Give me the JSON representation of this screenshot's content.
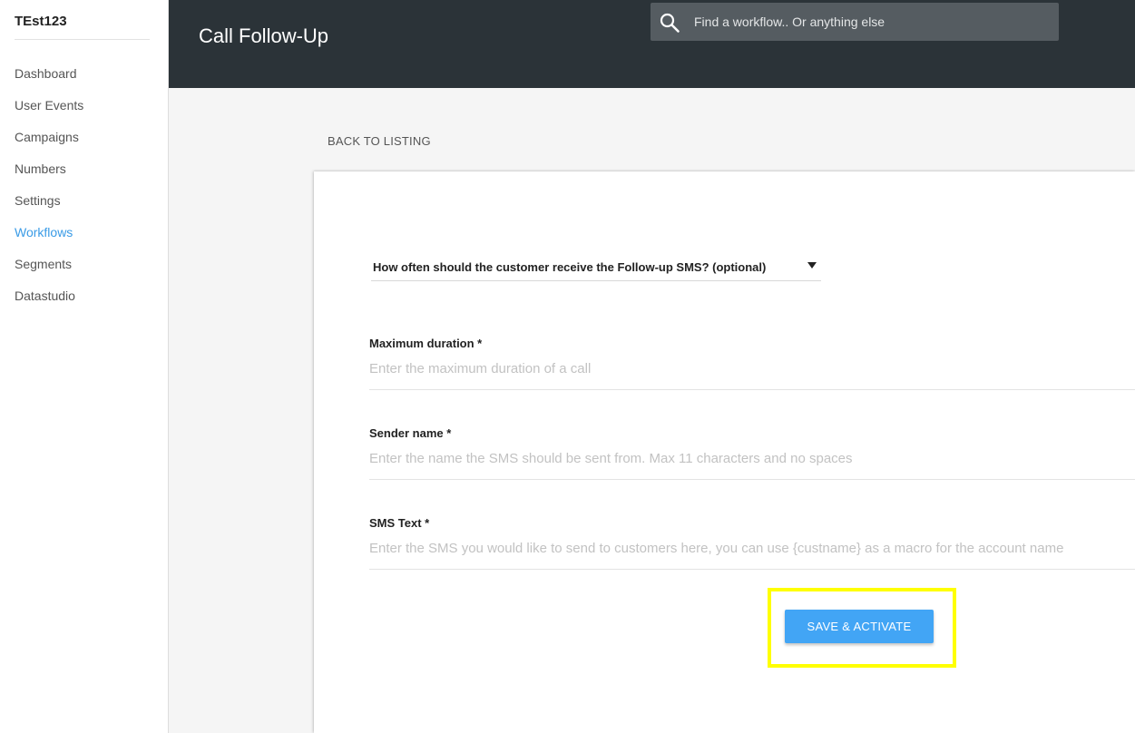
{
  "sidebar": {
    "account_name": "TEst123",
    "items": [
      {
        "label": "Dashboard"
      },
      {
        "label": "User Events"
      },
      {
        "label": "Campaigns"
      },
      {
        "label": "Numbers"
      },
      {
        "label": "Settings"
      },
      {
        "label": "Workflows",
        "active": true
      },
      {
        "label": "Segments"
      },
      {
        "label": "Datastudio"
      }
    ]
  },
  "header": {
    "title": "Call Follow-Up",
    "search": {
      "placeholder": "Find a workflow.. Or anything else",
      "icon": "search-icon"
    }
  },
  "main": {
    "back_link": "BACK TO LISTING",
    "frequency_select": {
      "value": "How often should the customer receive the Follow-up SMS? (optional)",
      "icon": "dropdown-arrow-icon"
    },
    "fields": {
      "max_duration": {
        "label": "Maximum duration *",
        "placeholder": "Enter the maximum duration of a call"
      },
      "sender_name": {
        "label": "Sender name *",
        "placeholder": "Enter the name the SMS should be sent from. Max 11 characters and no spaces"
      },
      "sms_text": {
        "label": "SMS Text *",
        "placeholder": "Enter the SMS you would like to send to customers here, you can use {custname} as a macro for the account name"
      }
    },
    "save_button": "SAVE & ACTIVATE"
  },
  "colors": {
    "header_bg": "#2b3338",
    "accent": "#3a9be6",
    "button": "#42a5f5",
    "highlight": "#ffff00"
  }
}
